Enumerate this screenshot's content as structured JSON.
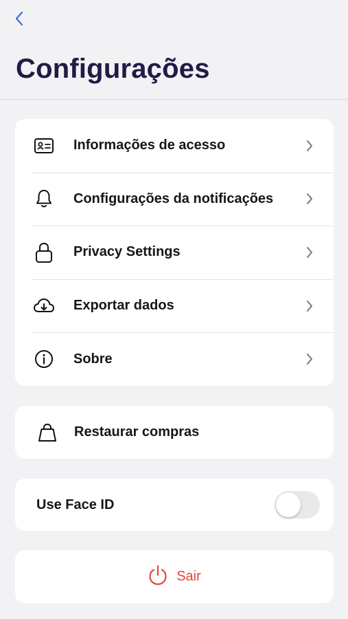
{
  "header": {
    "back_icon": "chevron-left-icon",
    "title": "Configurações"
  },
  "settings_menu": {
    "items": [
      {
        "label": "Informações de acesso",
        "icon": "id-card-icon"
      },
      {
        "label": "Configurações da notificações",
        "icon": "bell-icon"
      },
      {
        "label": "Privacy Settings",
        "icon": "lock-icon"
      },
      {
        "label": "Exportar dados",
        "icon": "cloud-download-icon"
      },
      {
        "label": "Sobre",
        "icon": "info-icon"
      }
    ]
  },
  "restore": {
    "label": "Restaurar compras",
    "icon": "shopping-bag-icon"
  },
  "face_id": {
    "label": "Use Face ID",
    "enabled": false
  },
  "logout": {
    "label": "Sair",
    "icon": "power-icon"
  },
  "colors": {
    "background": "#f2f2f5",
    "card": "#ffffff",
    "title": "#1f1c45",
    "accent_back": "#3a6fd8",
    "logout": "#e0463d",
    "toggle_off": "#e9e9ea"
  }
}
